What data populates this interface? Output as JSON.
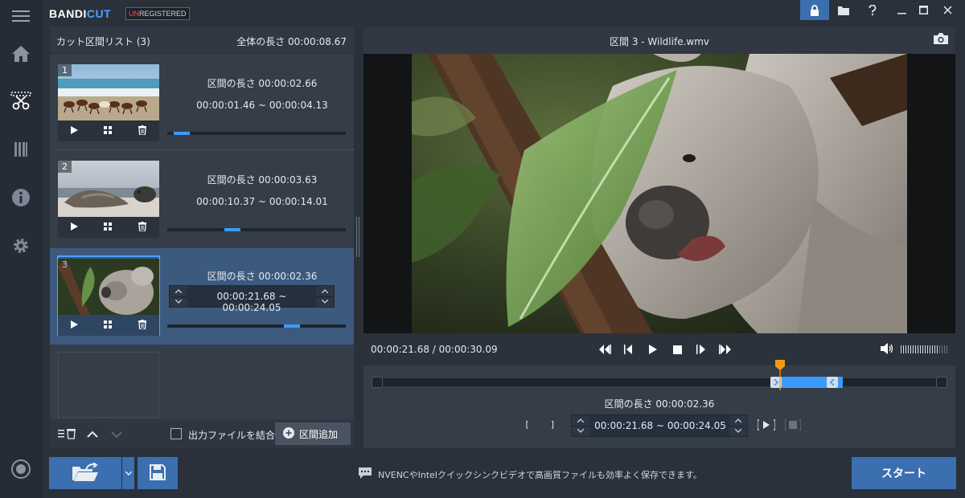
{
  "app": {
    "logo_main": "BANDI",
    "logo_accent": "CUT",
    "badge_un": "UN",
    "badge_rest": "REGISTERED"
  },
  "segment_list": {
    "title": "カット区間リスト (3)",
    "total_length": "全体の長さ 00:00:08.67",
    "segments": [
      {
        "number": "1",
        "length": "区間の長さ 00:00:02.66",
        "range": "00:00:01.46 ~ 00:00:04.13",
        "progress": 0.04
      },
      {
        "number": "2",
        "length": "区間の長さ 00:00:03.63",
        "range": "00:00:10.37 ~ 00:00:14.01",
        "progress": 0.35
      },
      {
        "number": "3",
        "length": "区間の長さ 00:00:02.36",
        "range": "00:00:21.68 ~ 00:00:24.05",
        "progress": 0.72
      }
    ],
    "merge_label": "出力ファイルを結合",
    "add_label": "区間追加"
  },
  "preview": {
    "title": "区間 3 - Wildlife.wmv",
    "timecode": "00:00:21.68 / 00:00:30.09",
    "selection_length": "区間の長さ 00:00:02.36",
    "start_time": "00:00:21.68",
    "tilde": "~",
    "end_time": "00:00:24.05",
    "volume_level": 0.8
  },
  "bottom": {
    "hint": "NVENCやIntelクイックシンクビデオで高画質ファイルも効率よく保存できます。",
    "start_label": "スタート"
  },
  "colors": {
    "accent": "#3a9bff",
    "button": "#3b6fb0",
    "playhead": "#f39c12"
  }
}
